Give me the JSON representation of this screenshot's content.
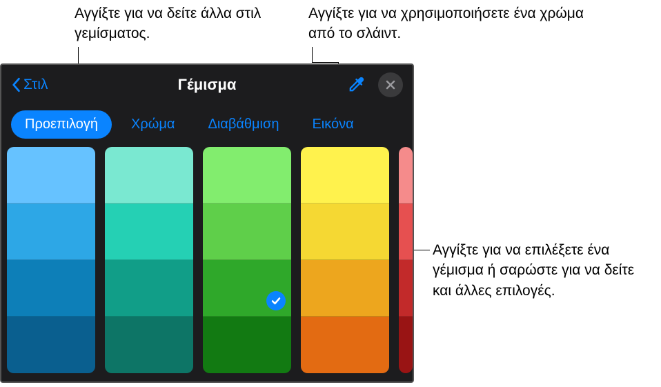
{
  "callouts": {
    "top_left": "Αγγίξτε για να δείτε άλλα στιλ γεμίσματος.",
    "top_right": "Αγγίξτε για να χρησιμοποιήσετε ένα χρώμα από το σλάιντ.",
    "right": "Αγγίξτε για να επιλέξετε ένα γέμισμα ή σαρώστε για να δείτε και άλλες επιλογές."
  },
  "panel": {
    "back_label": "Στιλ",
    "title": "Γέμισμα",
    "tabs": {
      "preset": "Προεπιλογή",
      "color": "Χρώμα",
      "gradient": "Διαβάθμιση",
      "image": "Εικόνα"
    }
  },
  "colors": {
    "accent": "#0a84ff",
    "panel_bg": "#1c1c1e",
    "close_bg": "#3a3a3c"
  },
  "swatches": {
    "columns": [
      [
        "#66c2ff",
        "#2da7e6",
        "#0d7fb8",
        "#0a5f8f"
      ],
      [
        "#7ae8d1",
        "#25d0b4",
        "#119e88",
        "#0d7566"
      ],
      [
        "#82ed6e",
        "#5fcf4a",
        "#2fa82a",
        "#127a12"
      ],
      [
        "#fff24d",
        "#f5d833",
        "#eda61e",
        "#e36b12"
      ],
      [
        "#f58b8b",
        "#e65050",
        "#c22a2a",
        "#991414"
      ]
    ],
    "selected": {
      "col": 2,
      "row": 2
    }
  }
}
